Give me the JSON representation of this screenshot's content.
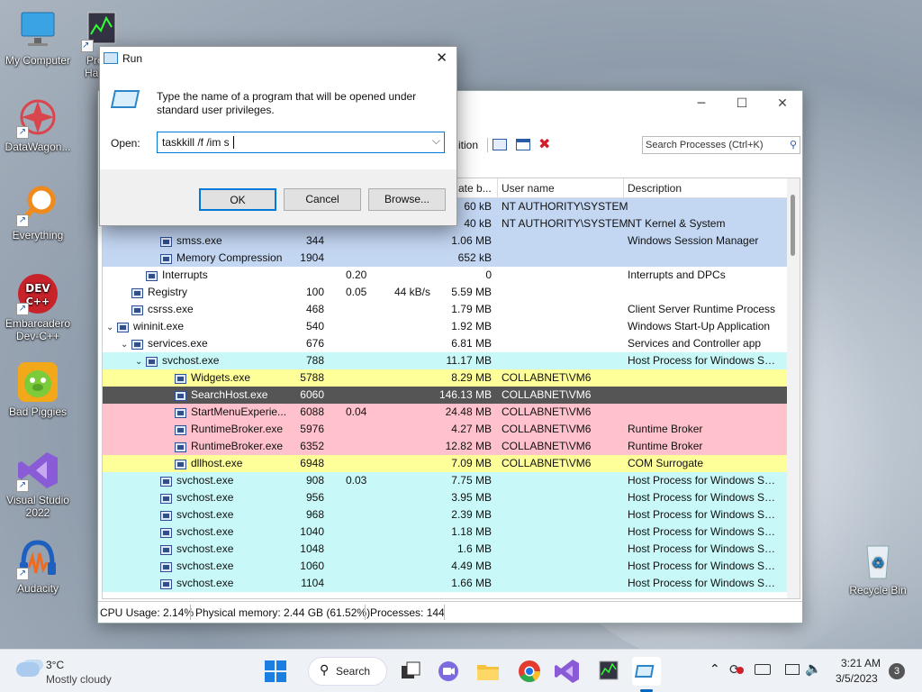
{
  "desktop": {
    "icons": [
      {
        "label_l1": "My Computer",
        "label_l2": ""
      },
      {
        "label_l1": "Pro",
        "label_l2": "Ha"
      },
      {
        "label_l1": "DataWagon...",
        "label_l2": ""
      },
      {
        "label_l1": "Everything",
        "label_l2": ""
      },
      {
        "label_l1": "Embarcadero",
        "label_l2": "Dev-C++"
      },
      {
        "label_l1": "Bad Piggies",
        "label_l2": ""
      },
      {
        "label_l1": "Visual Studio",
        "label_l2": "2022"
      },
      {
        "label_l1": "Audacity",
        "label_l2": ""
      },
      {
        "label_l1": "Recycle Bin",
        "label_l2": ""
      }
    ]
  },
  "run": {
    "title": "Run",
    "desc_line1": "Type the name of a program that will be opened under",
    "desc_line2": "standard user privileges.",
    "open_label": "Open:",
    "input_value": "taskkill /f /im s",
    "ok": "OK",
    "cancel": "Cancel",
    "browse": "Browse..."
  },
  "process_hacker": {
    "toolbar_partial": "ition",
    "search_placeholder": "Search Processes (Ctrl+K)",
    "columns": {
      "pb": "ate b...",
      "user": "User name",
      "desc": "Description"
    },
    "rows": [
      {
        "indent": 0,
        "tw": "",
        "name": "",
        "pid": "",
        "cpu": "",
        "io": "",
        "pb": "60 kB",
        "user": "NT AUTHORITY\\SYSTEM",
        "desc": "",
        "bg": "#c3d6f2"
      },
      {
        "indent": 2,
        "tw": "",
        "name": "",
        "pid": "",
        "cpu": "",
        "io": "",
        "pb": "40 kB",
        "user": "NT AUTHORITY\\SYSTEM",
        "desc": "NT Kernel & System",
        "bg": "#c3d6f2"
      },
      {
        "indent": 3,
        "tw": "",
        "name": "smss.exe",
        "pid": "344",
        "cpu": "",
        "io": "",
        "pb": "1.06 MB",
        "user": "",
        "desc": "Windows Session Manager",
        "bg": "#c3d6f2"
      },
      {
        "indent": 3,
        "tw": "",
        "name": "Memory Compression",
        "pid": "1904",
        "cpu": "",
        "io": "",
        "pb": "652 kB",
        "user": "",
        "desc": "",
        "bg": "#c3d6f2"
      },
      {
        "indent": 2,
        "tw": "",
        "name": "Interrupts",
        "pid": "",
        "cpu": "0.20",
        "io": "",
        "pb": "0",
        "user": "",
        "desc": "Interrupts and DPCs",
        "bg": "#ffffff"
      },
      {
        "indent": 1,
        "tw": "",
        "name": "Registry",
        "pid": "100",
        "cpu": "0.05",
        "io": "44 kB/s",
        "pb": "5.59 MB",
        "user": "",
        "desc": "",
        "bg": "#ffffff"
      },
      {
        "indent": 1,
        "tw": "",
        "name": "csrss.exe",
        "pid": "468",
        "cpu": "",
        "io": "",
        "pb": "1.79 MB",
        "user": "",
        "desc": "Client Server Runtime Process",
        "bg": "#ffffff"
      },
      {
        "indent": 0,
        "tw": "⌄",
        "name": "wininit.exe",
        "pid": "540",
        "cpu": "",
        "io": "",
        "pb": "1.92 MB",
        "user": "",
        "desc": "Windows Start-Up Application",
        "bg": "#ffffff"
      },
      {
        "indent": 1,
        "tw": "⌄",
        "name": "services.exe",
        "pid": "676",
        "cpu": "",
        "io": "",
        "pb": "6.81 MB",
        "user": "",
        "desc": "Services and Controller app",
        "bg": "#ffffff"
      },
      {
        "indent": 2,
        "tw": "⌄",
        "name": "svchost.exe",
        "pid": "788",
        "cpu": "",
        "io": "",
        "pb": "11.17 MB",
        "user": "",
        "desc": "Host Process for Windows Ser...",
        "bg": "#c8f8f8"
      },
      {
        "indent": 4,
        "tw": "",
        "name": "Widgets.exe",
        "pid": "5788",
        "cpu": "",
        "io": "",
        "pb": "8.29 MB",
        "user": "COLLABNET\\VM6",
        "desc": "",
        "bg": "#ffff99"
      },
      {
        "indent": 4,
        "tw": "",
        "name": "SearchHost.exe",
        "pid": "6060",
        "cpu": "",
        "io": "",
        "pb": "146.13 MB",
        "user": "COLLABNET\\VM6",
        "desc": "",
        "bg": "#555555"
      },
      {
        "indent": 4,
        "tw": "",
        "name": "StartMenuExperie...",
        "pid": "6088",
        "cpu": "0.04",
        "io": "",
        "pb": "24.48 MB",
        "user": "COLLABNET\\VM6",
        "desc": "",
        "bg": "#ffc1cc"
      },
      {
        "indent": 4,
        "tw": "",
        "name": "RuntimeBroker.exe",
        "pid": "5976",
        "cpu": "",
        "io": "",
        "pb": "4.27 MB",
        "user": "COLLABNET\\VM6",
        "desc": "Runtime Broker",
        "bg": "#ffc1cc"
      },
      {
        "indent": 4,
        "tw": "",
        "name": "RuntimeBroker.exe",
        "pid": "6352",
        "cpu": "",
        "io": "",
        "pb": "12.82 MB",
        "user": "COLLABNET\\VM6",
        "desc": "Runtime Broker",
        "bg": "#ffc1cc"
      },
      {
        "indent": 4,
        "tw": "",
        "name": "dllhost.exe",
        "pid": "6948",
        "cpu": "",
        "io": "",
        "pb": "7.09 MB",
        "user": "COLLABNET\\VM6",
        "desc": "COM Surrogate",
        "bg": "#ffff99"
      },
      {
        "indent": 3,
        "tw": "",
        "name": "svchost.exe",
        "pid": "908",
        "cpu": "0.03",
        "io": "",
        "pb": "7.75 MB",
        "user": "",
        "desc": "Host Process for Windows Ser...",
        "bg": "#c8f8f8"
      },
      {
        "indent": 3,
        "tw": "",
        "name": "svchost.exe",
        "pid": "956",
        "cpu": "",
        "io": "",
        "pb": "3.95 MB",
        "user": "",
        "desc": "Host Process for Windows Ser...",
        "bg": "#c8f8f8"
      },
      {
        "indent": 3,
        "tw": "",
        "name": "svchost.exe",
        "pid": "968",
        "cpu": "",
        "io": "",
        "pb": "2.39 MB",
        "user": "",
        "desc": "Host Process for Windows Ser...",
        "bg": "#c8f8f8"
      },
      {
        "indent": 3,
        "tw": "",
        "name": "svchost.exe",
        "pid": "1040",
        "cpu": "",
        "io": "",
        "pb": "1.18 MB",
        "user": "",
        "desc": "Host Process for Windows Ser...",
        "bg": "#c8f8f8"
      },
      {
        "indent": 3,
        "tw": "",
        "name": "svchost.exe",
        "pid": "1048",
        "cpu": "",
        "io": "",
        "pb": "1.6 MB",
        "user": "",
        "desc": "Host Process for Windows Ser...",
        "bg": "#c8f8f8"
      },
      {
        "indent": 3,
        "tw": "",
        "name": "svchost.exe",
        "pid": "1060",
        "cpu": "",
        "io": "",
        "pb": "4.49 MB",
        "user": "",
        "desc": "Host Process for Windows Ser...",
        "bg": "#c8f8f8"
      },
      {
        "indent": 3,
        "tw": "",
        "name": "svchost.exe",
        "pid": "1104",
        "cpu": "",
        "io": "",
        "pb": "1.66 MB",
        "user": "",
        "desc": "Host Process for Windows Ser...",
        "bg": "#c8f8f8"
      }
    ],
    "status": {
      "cpu": "CPU Usage: 2.14%",
      "mem": "Physical memory: 2.44 GB (61.52%)",
      "procs": "Processes: 144"
    }
  },
  "taskbar": {
    "weather_temp": "3°C",
    "weather_desc": "Mostly cloudy",
    "search_label": "Search",
    "time": "3:21 AM",
    "date": "3/5/2023",
    "notif_count": "3"
  }
}
